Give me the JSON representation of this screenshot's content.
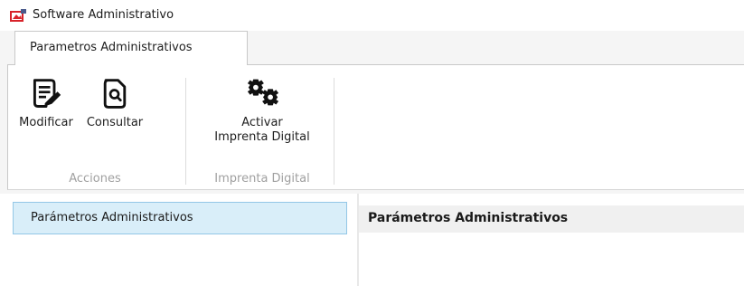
{
  "window": {
    "title": "Software Administrativo",
    "icon": "app-logo-icon"
  },
  "ribbon": {
    "tabs": [
      {
        "label": "Parametros Administrativos",
        "active": true
      }
    ],
    "groups": [
      {
        "label": "Acciones",
        "buttons": [
          {
            "label": "Modificar",
            "icon": "edit-document-icon"
          },
          {
            "label": "Consultar",
            "icon": "search-document-icon"
          }
        ]
      },
      {
        "label": "Imprenta Digital",
        "buttons": [
          {
            "label_line1": "Activar",
            "label_line2": "Imprenta Digital",
            "icon": "gears-icon"
          }
        ]
      }
    ]
  },
  "nav": {
    "items": [
      {
        "label": "Parámetros Administrativos",
        "selected": true
      }
    ]
  },
  "content": {
    "header": "Parámetros Administrativos"
  },
  "colors": {
    "nav_selected_bg": "#d9eef9",
    "nav_selected_border": "#93c7e6",
    "group_label": "#a0a0a0",
    "app_icon_red": "#d8232a"
  }
}
